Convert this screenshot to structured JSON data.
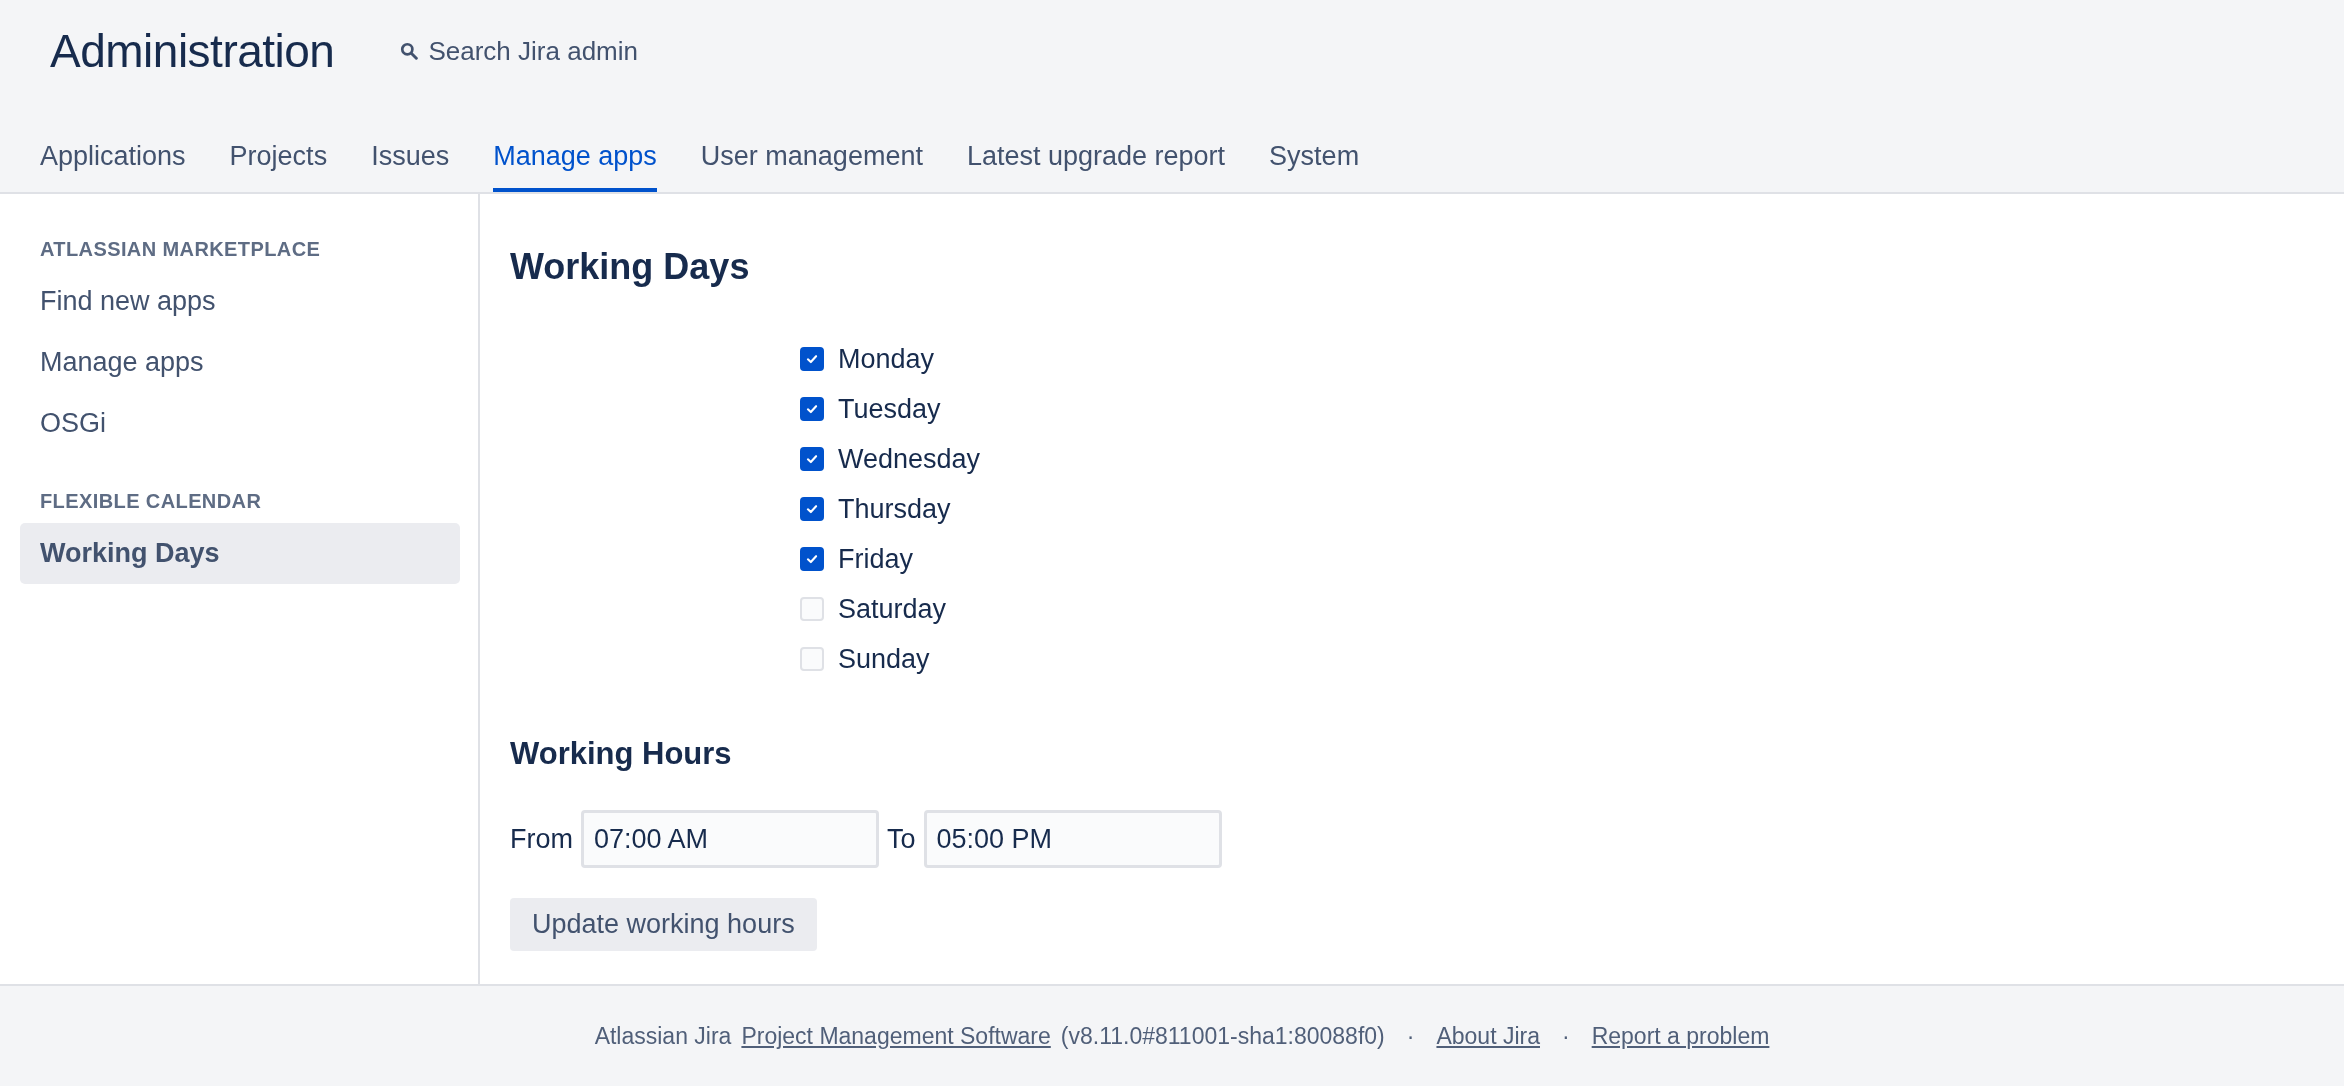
{
  "header": {
    "title": "Administration",
    "search": {
      "label": "Search Jira admin"
    }
  },
  "tabs": [
    {
      "label": "Applications",
      "selected": false
    },
    {
      "label": "Projects",
      "selected": false
    },
    {
      "label": "Issues",
      "selected": false
    },
    {
      "label": "Manage apps",
      "selected": true
    },
    {
      "label": "User management",
      "selected": false
    },
    {
      "label": "Latest upgrade report",
      "selected": false
    },
    {
      "label": "System",
      "selected": false
    }
  ],
  "sidebar": {
    "sections": [
      {
        "heading": "ATLASSIAN MARKETPLACE",
        "items": [
          {
            "label": "Find new apps",
            "selected": false
          },
          {
            "label": "Manage apps",
            "selected": false
          },
          {
            "label": "OSGi",
            "selected": false
          }
        ]
      },
      {
        "heading": "FLEXIBLE CALENDAR",
        "items": [
          {
            "label": "Working Days",
            "selected": true
          }
        ]
      }
    ]
  },
  "main": {
    "title": "Working Days",
    "days": [
      {
        "label": "Monday",
        "checked": true
      },
      {
        "label": "Tuesday",
        "checked": true
      },
      {
        "label": "Wednesday",
        "checked": true
      },
      {
        "label": "Thursday",
        "checked": true
      },
      {
        "label": "Friday",
        "checked": true
      },
      {
        "label": "Saturday",
        "checked": false
      },
      {
        "label": "Sunday",
        "checked": false
      }
    ],
    "hours_title": "Working Hours",
    "from_label": "From",
    "from_value": "07:00 AM",
    "to_label": "To",
    "to_value": "05:00 PM",
    "button": "Update working hours"
  },
  "footer": {
    "parts": [
      {
        "kind": "text",
        "text": "Atlassian Jira"
      },
      {
        "kind": "link",
        "text": "Project Management Software"
      },
      {
        "kind": "text",
        "text": "(v8.11.0#811001-sha1:80088f0)"
      },
      {
        "kind": "sep",
        "text": "·"
      },
      {
        "kind": "link",
        "text": "About Jira"
      },
      {
        "kind": "sep",
        "text": "·"
      },
      {
        "kind": "link",
        "text": "Report a problem"
      }
    ]
  }
}
